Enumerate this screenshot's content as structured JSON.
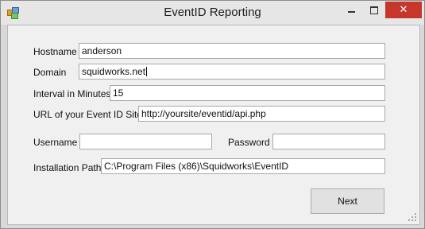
{
  "window": {
    "title": "EventID Reporting",
    "close_glyph": "✕"
  },
  "form": {
    "hostname_label": "Hostname",
    "hostname_value": "anderson",
    "domain_label": "Domain",
    "domain_value": "squidworks.net",
    "interval_label": "Interval in Minutes",
    "interval_value": "15",
    "url_label": "URL of your Event ID Site",
    "url_value": "http://yoursite/eventid/api.php",
    "username_label": "Username",
    "username_value": "",
    "password_label": "Password",
    "password_value": "",
    "install_path_label": "Installation Path",
    "install_path_value": "C:\\Program Files (x86)\\Squidworks\\EventID"
  },
  "buttons": {
    "next_label": "Next"
  },
  "colors": {
    "close_button": "#c7362b",
    "window_frame": "#d9d9d9",
    "client_background": "#f0f0f0"
  }
}
